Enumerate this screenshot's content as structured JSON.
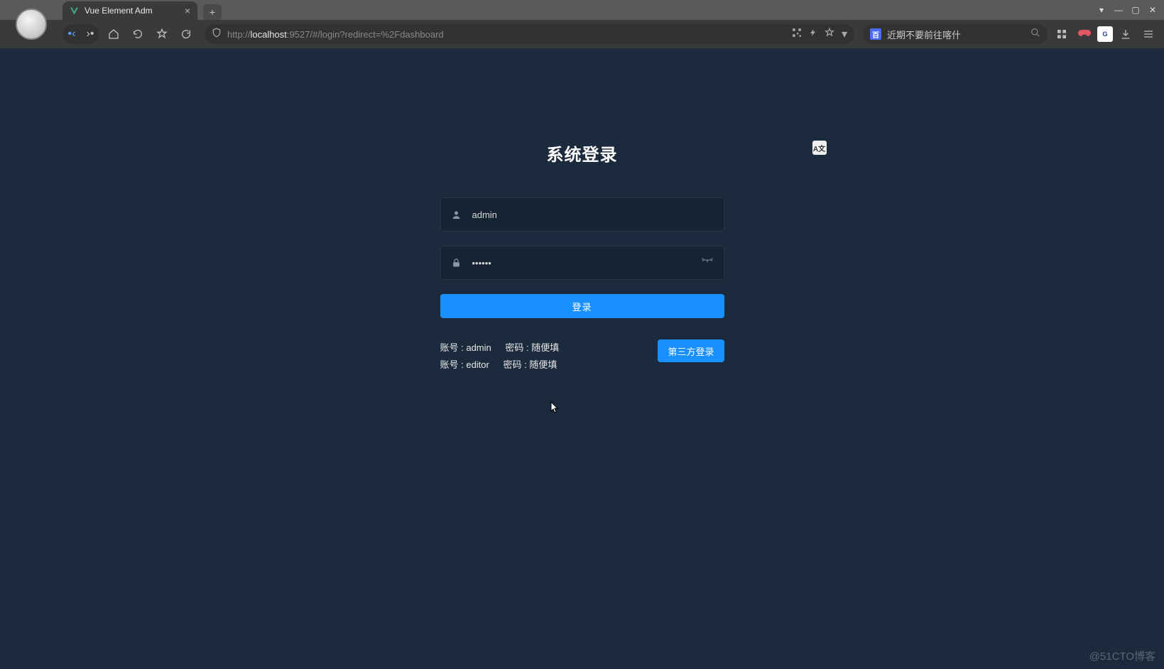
{
  "browser": {
    "tab_title": "Vue Element Adm",
    "url_proto_host": "http://",
    "url_host": "localhost",
    "url_port_path": ":9527/#/login?redirect=%2Fdashboard",
    "search_placeholder": "近期不要前往喀什"
  },
  "login": {
    "title": "系统登录",
    "lang_label": "A文",
    "username_value": "admin",
    "password_masked": "••••••",
    "login_btn": "登录",
    "third_party_btn": "第三方登录",
    "tips": [
      {
        "account": "账号 : admin",
        "password": "密码 : 随便填"
      },
      {
        "account": "账号 : editor",
        "password": "密码 : 随便填"
      }
    ]
  },
  "watermark": "@51CTO博客"
}
